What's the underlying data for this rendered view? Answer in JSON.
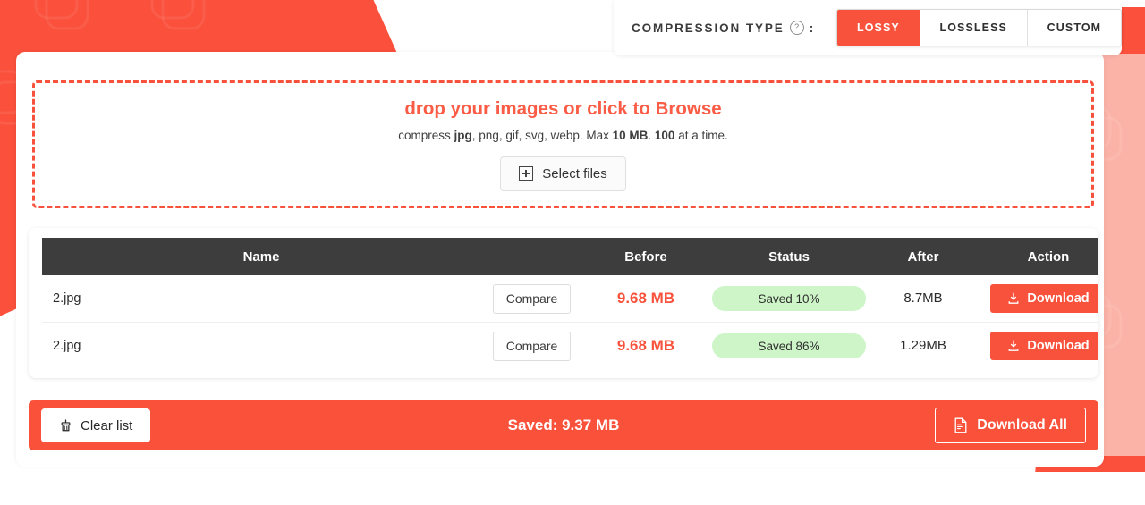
{
  "theme": {
    "accent": "#f9523c",
    "accent_soft": "#fbb3a7",
    "header_dark": "#3d3d3d",
    "status_green_bg": "#cdf5c8",
    "white": "#ffffff"
  },
  "topbar": {
    "label": "COMPRESSION TYPE",
    "help_glyph": "?",
    "colon": ":",
    "options": [
      {
        "label": "LOSSY",
        "active": true
      },
      {
        "label": "LOSSLESS",
        "active": false
      },
      {
        "label": "CUSTOM",
        "active": false
      }
    ]
  },
  "dropzone": {
    "title": "drop your images or click to Browse",
    "subtitle_parts": [
      {
        "text": "compress ",
        "bold": false
      },
      {
        "text": "jpg",
        "bold": true
      },
      {
        "text": ", png, gif, svg, webp. Max ",
        "bold": false
      },
      {
        "text": "10 MB",
        "bold": true
      },
      {
        "text": ". ",
        "bold": false
      },
      {
        "text": "100",
        "bold": true
      },
      {
        "text": " at a time.",
        "bold": false
      }
    ],
    "subtitle_plain": "compress jpg, png, gif, svg, webp. Max 10 MB. 100 at a time.",
    "select_button": "Select files",
    "select_icon": "plus-square-icon"
  },
  "table": {
    "headers": {
      "name": "Name",
      "compare": "",
      "before": "Before",
      "status": "Status",
      "after": "After",
      "action": "Action"
    },
    "rows": [
      {
        "name": "2.jpg",
        "compare_label": "Compare",
        "before": "9.68 MB",
        "status": "Saved 10%",
        "after": "8.7MB",
        "download_label": "Download",
        "download_icon": "download-icon"
      },
      {
        "name": "2.jpg",
        "compare_label": "Compare",
        "before": "9.68 MB",
        "status": "Saved 86%",
        "after": "1.29MB",
        "download_label": "Download",
        "download_icon": "download-icon"
      }
    ]
  },
  "footer": {
    "clear_label": "Clear list",
    "clear_icon": "broom-icon",
    "saved_total": "Saved: 9.37 MB",
    "download_all_label": "Download All",
    "download_all_icon": "file-icon"
  }
}
